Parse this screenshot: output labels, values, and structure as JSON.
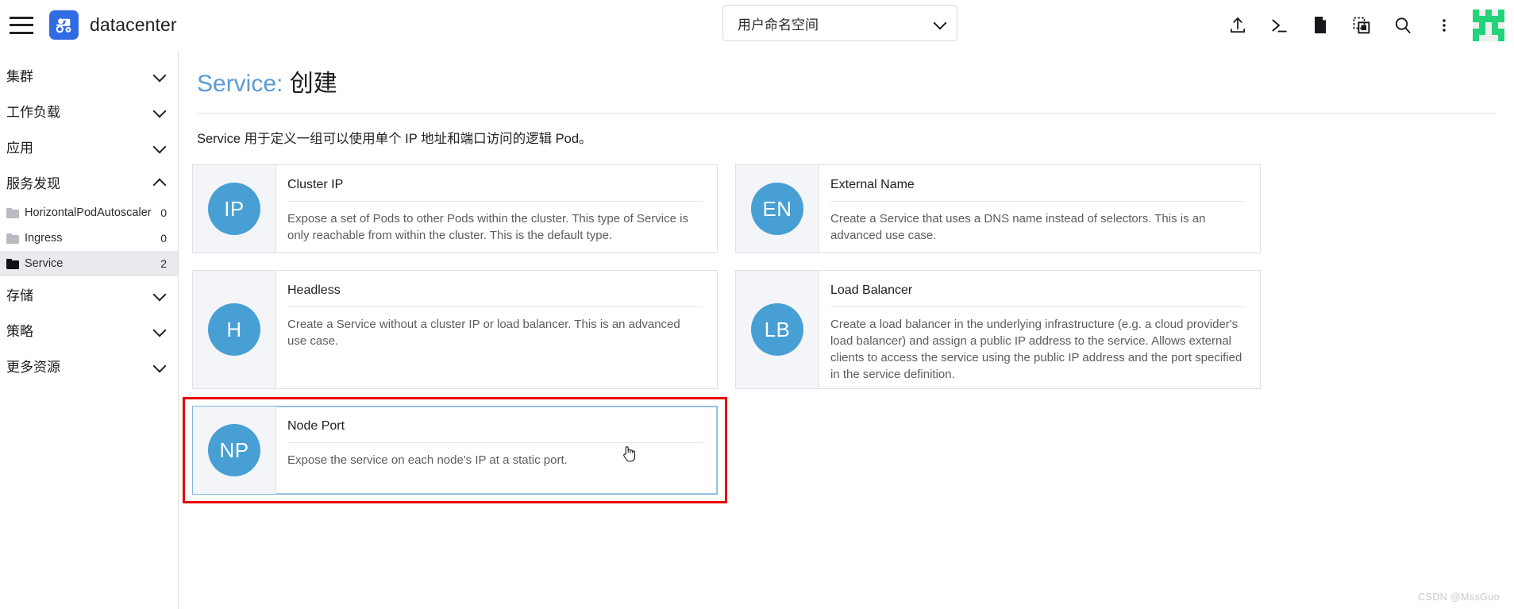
{
  "header": {
    "menu_icon": "hamburger-icon",
    "logo_icon": "kubernetes-dashboard-logo",
    "brand": "datacenter",
    "namespace_select": {
      "value": "用户命名空间",
      "chevron_icon": "chevron-down-icon"
    },
    "icons": [
      {
        "name": "upload-icon",
        "label": "上传"
      },
      {
        "name": "terminal-icon",
        "label": "终端"
      },
      {
        "name": "document-icon",
        "label": "文档"
      },
      {
        "name": "clone-icon",
        "label": "复制"
      },
      {
        "name": "search-icon",
        "label": "搜索"
      },
      {
        "name": "more-vertical-icon",
        "label": "更多"
      }
    ],
    "avatar": {
      "name": "user-identicon",
      "color": "#22d37a"
    }
  },
  "sidebar": {
    "groups": [
      {
        "label": "集群",
        "expanded": false
      },
      {
        "label": "工作负载",
        "expanded": false
      },
      {
        "label": "应用",
        "expanded": false
      },
      {
        "label": "服务发现",
        "expanded": true
      },
      {
        "label": "存储",
        "expanded": false
      },
      {
        "label": "策略",
        "expanded": false
      },
      {
        "label": "更多资源",
        "expanded": false
      }
    ],
    "service_discovery_items": [
      {
        "label": "HorizontalPodAutoscaler",
        "count": "0",
        "selected": false
      },
      {
        "label": "Ingress",
        "count": "0",
        "selected": false
      },
      {
        "label": "Service",
        "count": "2",
        "selected": true
      }
    ]
  },
  "main": {
    "title_prefix": "Service:",
    "title_suffix": "创建",
    "description": "Service 用于定义一组可以使用单个 IP 地址和端口访问的逻辑 Pod。",
    "cards": [
      {
        "badge": "IP",
        "title": "Cluster IP",
        "text": "Expose a set of Pods to other Pods within the cluster. This type of Service is only reachable from within the cluster. This is the default type."
      },
      {
        "badge": "EN",
        "title": "External Name",
        "text": "Create a Service that uses a DNS name instead of selectors. This is an advanced use case."
      },
      {
        "badge": "H",
        "title": "Headless",
        "text": "Create a Service without a cluster IP or load balancer. This is an advanced use case."
      },
      {
        "badge": "LB",
        "title": "Load Balancer",
        "text": "Create a load balancer in the underlying infrastructure (e.g. a cloud provider's load balancer) and assign a public IP address to the service. Allows external clients to access the service using the public IP address and the port specified in the service definition."
      },
      {
        "badge": "NP",
        "title": "Node Port",
        "text": "Expose the service on each node's IP at a static port."
      }
    ]
  },
  "annotation": {
    "highlight_color": "#e60000",
    "target": "Node Port"
  },
  "watermark": "CSDN @MssGuo",
  "colors": {
    "accent_blue": "#5b9bd5",
    "badge_blue": "#479fd4",
    "logo_blue": "#326ce5",
    "selected_bg": "#e9eaee"
  }
}
